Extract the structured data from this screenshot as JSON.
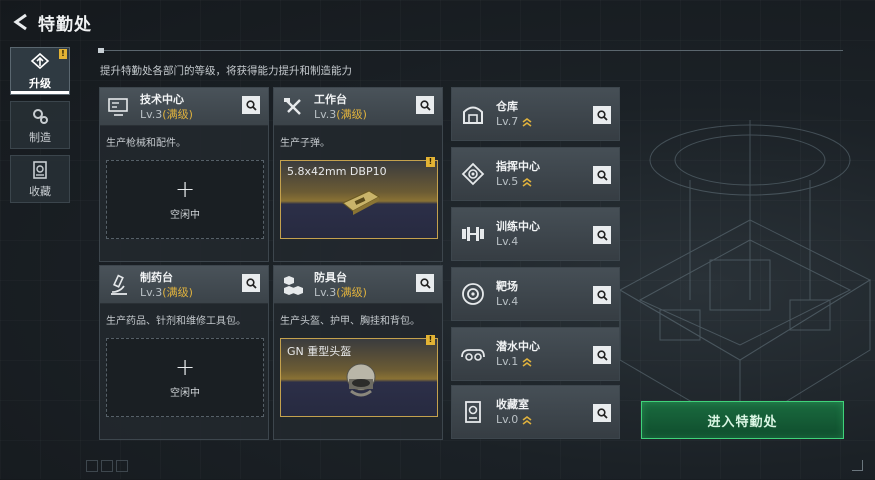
{
  "header": {
    "title": "特勤处"
  },
  "sidebar": [
    {
      "label": "升级",
      "icon": "upgrade-icon",
      "active": true,
      "badge": "!"
    },
    {
      "label": "制造",
      "icon": "gears-icon",
      "active": false
    },
    {
      "label": "收藏",
      "icon": "collection-icon",
      "active": false
    }
  ],
  "description": "提升特勤处各部门的等级，将获得能力提升和制造能力",
  "workshops": [
    {
      "name": "技术中心",
      "level": "Lv.3",
      "max": "(满级)",
      "desc": "生产枪械和配件。",
      "slot": {
        "plus": "+",
        "idle": "空闲中"
      }
    },
    {
      "name": "工作台",
      "level": "Lv.3",
      "max": "(满级)",
      "desc": "生产子弹。",
      "product": {
        "name": "5.8x42mm DBP10",
        "badge": "!"
      }
    },
    {
      "name": "制药台",
      "level": "Lv.3",
      "max": "(满级)",
      "desc": "生产药品、针剂和维修工具包。",
      "slot": {
        "plus": "+",
        "idle": "空闲中"
      }
    },
    {
      "name": "防具台",
      "level": "Lv.3",
      "max": "(满级)",
      "desc": "生产头盔、护甲、胸挂和背包。",
      "product": {
        "name": "GN 重型头盔",
        "badge": "!"
      }
    }
  ],
  "facilities": [
    {
      "name": "仓库",
      "level": "Lv.7",
      "upgradable": true,
      "icon": "warehouse-icon"
    },
    {
      "name": "指挥中心",
      "level": "Lv.5",
      "upgradable": true,
      "icon": "command-center-icon"
    },
    {
      "name": "训练中心",
      "level": "Lv.4",
      "upgradable": false,
      "icon": "dumbbell-icon"
    },
    {
      "name": "靶场",
      "level": "Lv.4",
      "upgradable": false,
      "icon": "target-icon"
    },
    {
      "name": "潜水中心",
      "level": "Lv.1",
      "upgradable": true,
      "icon": "diving-mask-icon"
    },
    {
      "name": "收藏室",
      "level": "Lv.0",
      "upgradable": true,
      "icon": "collection-room-icon"
    }
  ],
  "enter_button": "进入特勤处",
  "colors": {
    "accent_green": "#1a6b3f",
    "gold": "#e0b23d",
    "badge": "#e3b334"
  }
}
